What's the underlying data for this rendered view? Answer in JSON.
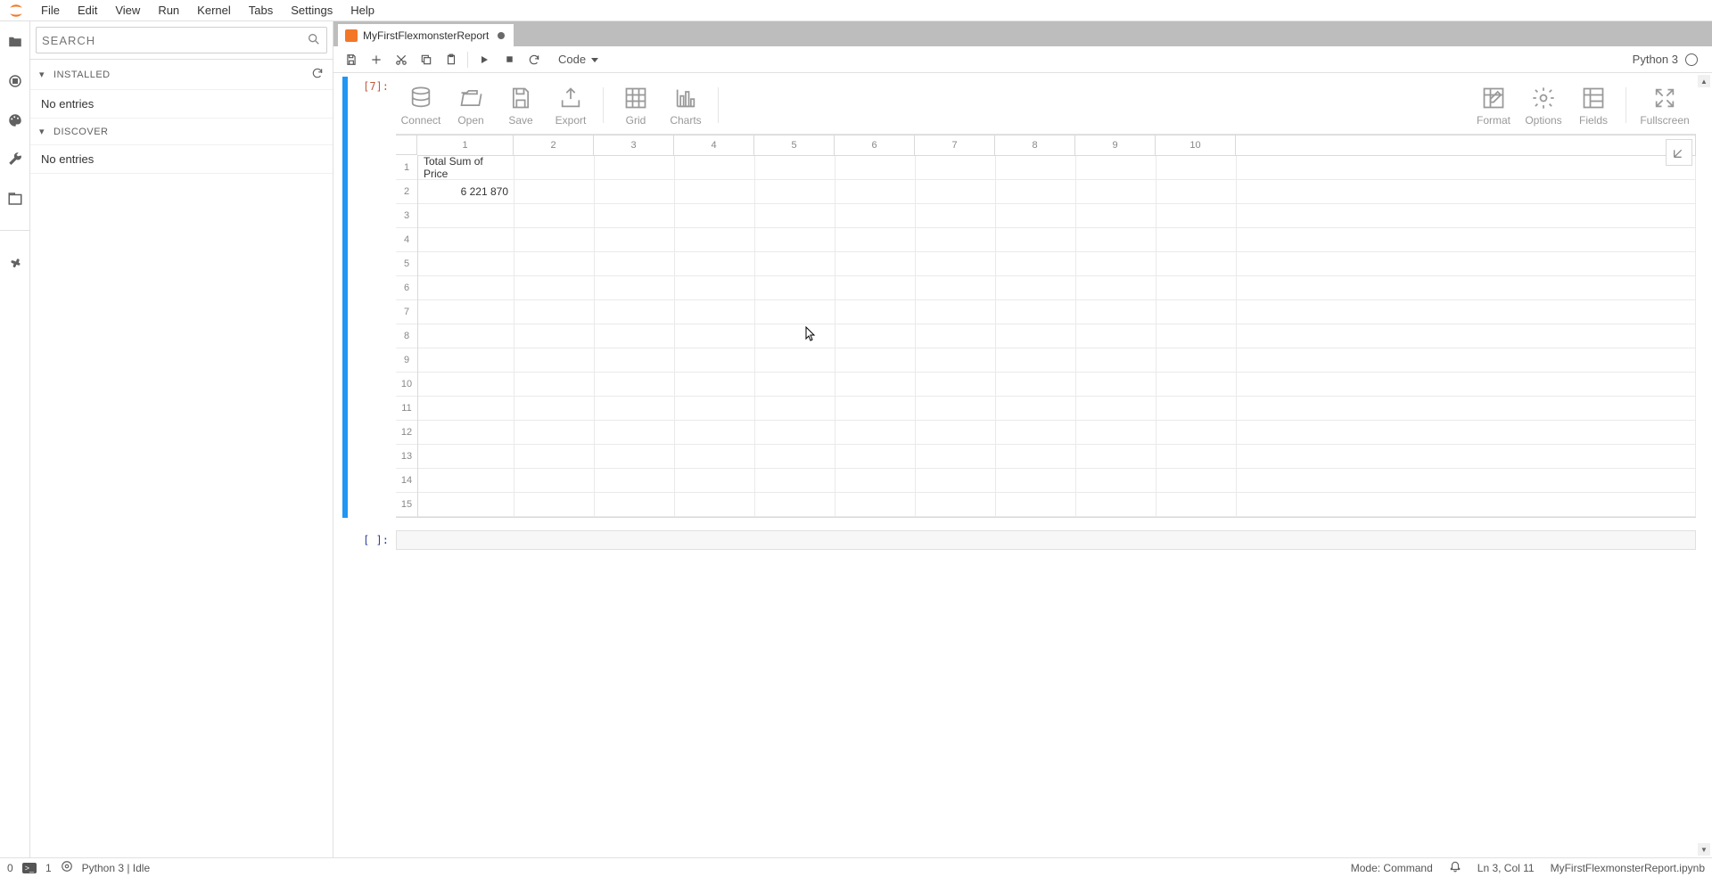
{
  "menu": {
    "file": "File",
    "edit": "Edit",
    "view": "View",
    "run": "Run",
    "kernel": "Kernel",
    "tabs": "Tabs",
    "settings": "Settings",
    "help": "Help"
  },
  "leftPanel": {
    "searchPlaceholder": "SEARCH",
    "installed": {
      "title": "INSTALLED",
      "entry": "No entries"
    },
    "discover": {
      "title": "DISCOVER",
      "entry": "No entries"
    }
  },
  "tab": {
    "title": "MyFirstFlexmonsterReport"
  },
  "nbToolbar": {
    "cellType": "Code",
    "kernel": "Python 3"
  },
  "cell": {
    "prompt": "[7]:",
    "emptyPrompt": "[  ]:"
  },
  "fmToolbar": {
    "connect": "Connect",
    "open": "Open",
    "save": "Save",
    "export": "Export",
    "grid": "Grid",
    "charts": "Charts",
    "format": "Format",
    "options": "Options",
    "fields": "Fields",
    "fullscreen": "Fullscreen"
  },
  "grid": {
    "colHeaders": [
      "1",
      "2",
      "3",
      "4",
      "5",
      "6",
      "7",
      "8",
      "9",
      "10"
    ],
    "rowHeaders": [
      "1",
      "2",
      "3",
      "4",
      "5",
      "6",
      "7",
      "8",
      "9",
      "10",
      "11",
      "12",
      "13",
      "14",
      "15"
    ],
    "cells": {
      "r1c1": "Total Sum of Price",
      "r2c1": "6 221 870"
    }
  },
  "statusbar": {
    "zero": "0",
    "one": "1",
    "kernel": "Python 3 | Idle",
    "mode": "Mode: Command",
    "lncol": "Ln 3, Col 11",
    "filename": "MyFirstFlexmonsterReport.ipynb"
  },
  "chart_data": {
    "type": "table",
    "title": "Total Sum of Price",
    "values": [
      [
        6221870
      ]
    ]
  }
}
